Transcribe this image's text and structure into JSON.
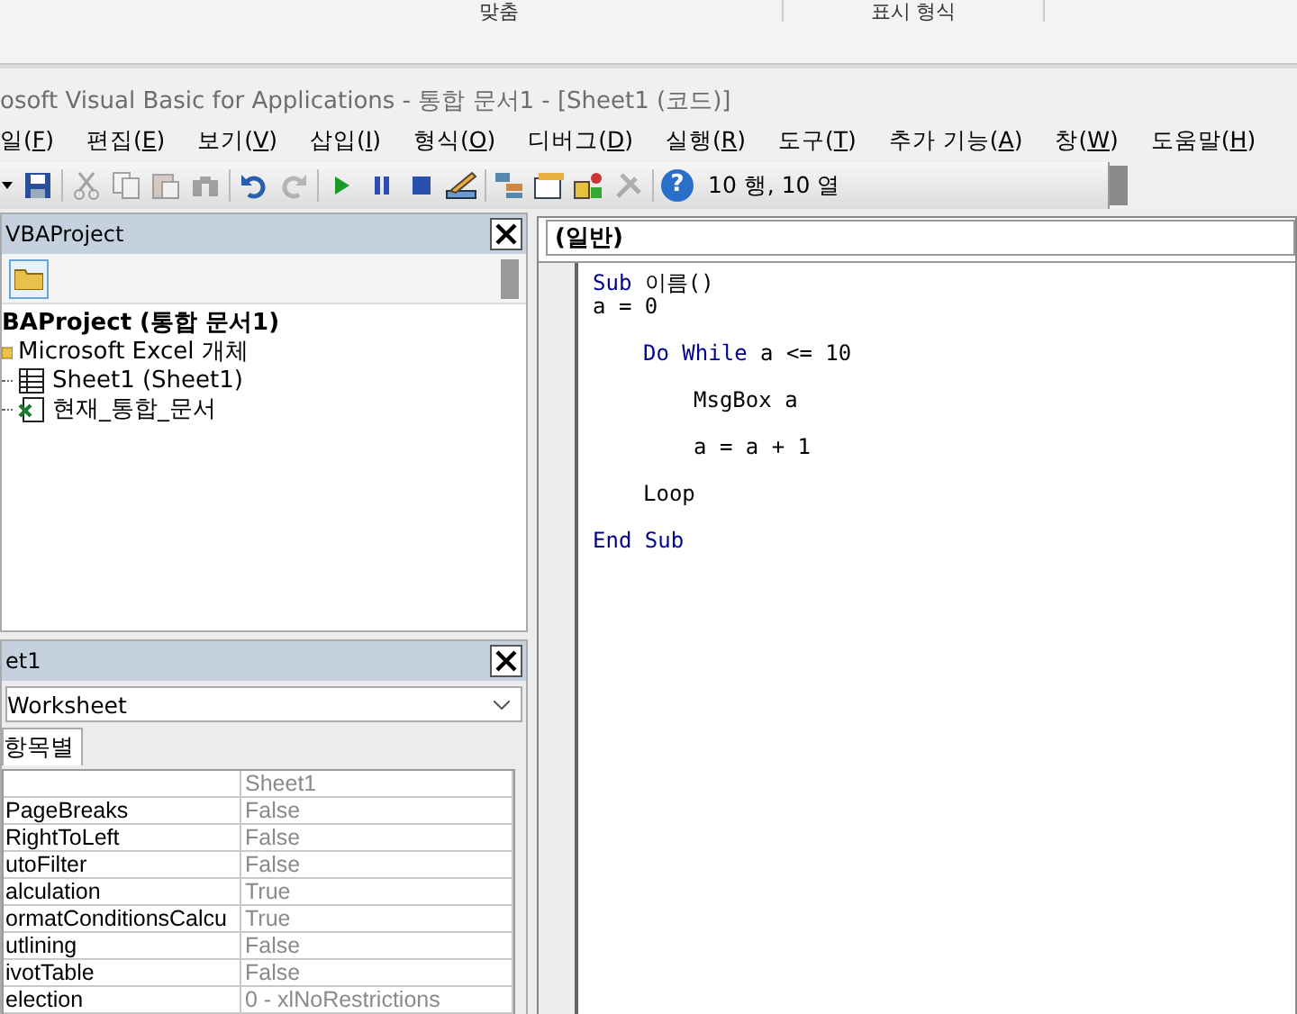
{
  "ribbon": {
    "groups": [
      {
        "label": "맞춤"
      },
      {
        "label": "표시 형식"
      }
    ]
  },
  "window": {
    "title": "osoft Visual Basic for Applications - 통합 문서1 - [Sheet1 (코드)]"
  },
  "menu": [
    "일(F)",
    "편집(E)",
    "보기(V)",
    "삽입(I)",
    "형식(O)",
    "디버그(D)",
    "실행(R)",
    "도구(T)",
    "추가 기능(A)",
    "창(W)",
    "도움말(H)"
  ],
  "toolbar": {
    "buttons": [
      {
        "kind": "dropdown",
        "disabled": false
      },
      {
        "kind": "save",
        "disabled": false
      },
      {
        "kind": "cut",
        "disabled": true
      },
      {
        "kind": "copy",
        "disabled": true
      },
      {
        "kind": "paste",
        "disabled": true
      },
      {
        "kind": "find",
        "disabled": true
      },
      {
        "kind": "undo",
        "disabled": false
      },
      {
        "kind": "redo",
        "disabled": true
      },
      {
        "kind": "run",
        "disabled": false
      },
      {
        "kind": "pause",
        "disabled": false
      },
      {
        "kind": "stop",
        "disabled": false
      },
      {
        "kind": "design",
        "disabled": false
      },
      {
        "kind": "explorer",
        "disabled": false
      },
      {
        "kind": "properties",
        "disabled": false
      },
      {
        "kind": "objects",
        "disabled": false
      },
      {
        "kind": "tools",
        "disabled": true
      },
      {
        "kind": "help",
        "disabled": false,
        "text": "?"
      }
    ],
    "position": "10 행, 10 열"
  },
  "project_explorer": {
    "title": "VBAProject",
    "tree": [
      {
        "label": "BAProject (통합 문서1)",
        "kind": "project",
        "children": [
          {
            "label": "Microsoft Excel 개체",
            "kind": "folder",
            "children": [
              {
                "label": "Sheet1 (Sheet1)",
                "kind": "sheet"
              },
              {
                "label": "현재_통합_문서",
                "kind": "workbook"
              }
            ]
          }
        ]
      }
    ]
  },
  "properties": {
    "title": "et1",
    "object": "Worksheet",
    "tabs": [
      {
        "label": "항목별",
        "selected": true
      }
    ],
    "rows": [
      {
        "value": "Sheet1"
      },
      {
        "name": "PageBreaks",
        "value": "False"
      },
      {
        "name": "RightToLeft",
        "value": "False"
      },
      {
        "name": "utoFilter",
        "value": "False"
      },
      {
        "name": "alculation",
        "value": "True"
      },
      {
        "name": "ormatConditionsCalcu",
        "value": "True"
      },
      {
        "name": "utlining",
        "value": "False"
      },
      {
        "name": "ivotTable",
        "value": "False"
      },
      {
        "name": "election",
        "value": "0 - xlNoRestrictions"
      }
    ]
  },
  "code_window": {
    "object": "(일반)",
    "lines": [
      {
        "kind": "code",
        "segments": [
          {
            "kind": "keyword",
            "text": "Sub"
          },
          {
            "kind": "plain",
            "text": " 이름()"
          }
        ]
      },
      {
        "kind": "code",
        "segments": [
          {
            "kind": "plain",
            "text": "a = 0"
          }
        ],
        "children": [
          {
            "kind": "blank"
          },
          {
            "kind": "code",
            "segments": [
              {
                "kind": "keyword",
                "text": "Do While"
              },
              {
                "kind": "plain",
                "text": " a <= 10"
              }
            ],
            "children": [
              {
                "kind": "blank"
              },
              {
                "kind": "code",
                "segments": [
                  {
                    "kind": "plain",
                    "text": "MsgBox a"
                  }
                ]
              },
              {
                "kind": "blank"
              },
              {
                "kind": "code",
                "segments": [
                  {
                    "kind": "plain",
                    "text": "a = a + 1"
                  }
                ]
              }
            ]
          },
          {
            "kind": "blank"
          },
          {
            "kind": "code",
            "segments": [
              {
                "kind": "plain",
                "text": "Loop"
              }
            ]
          }
        ]
      },
      {
        "kind": "blank"
      },
      {
        "kind": "code",
        "segments": [
          {
            "kind": "keyword",
            "text": "End Sub"
          }
        ]
      }
    ]
  }
}
